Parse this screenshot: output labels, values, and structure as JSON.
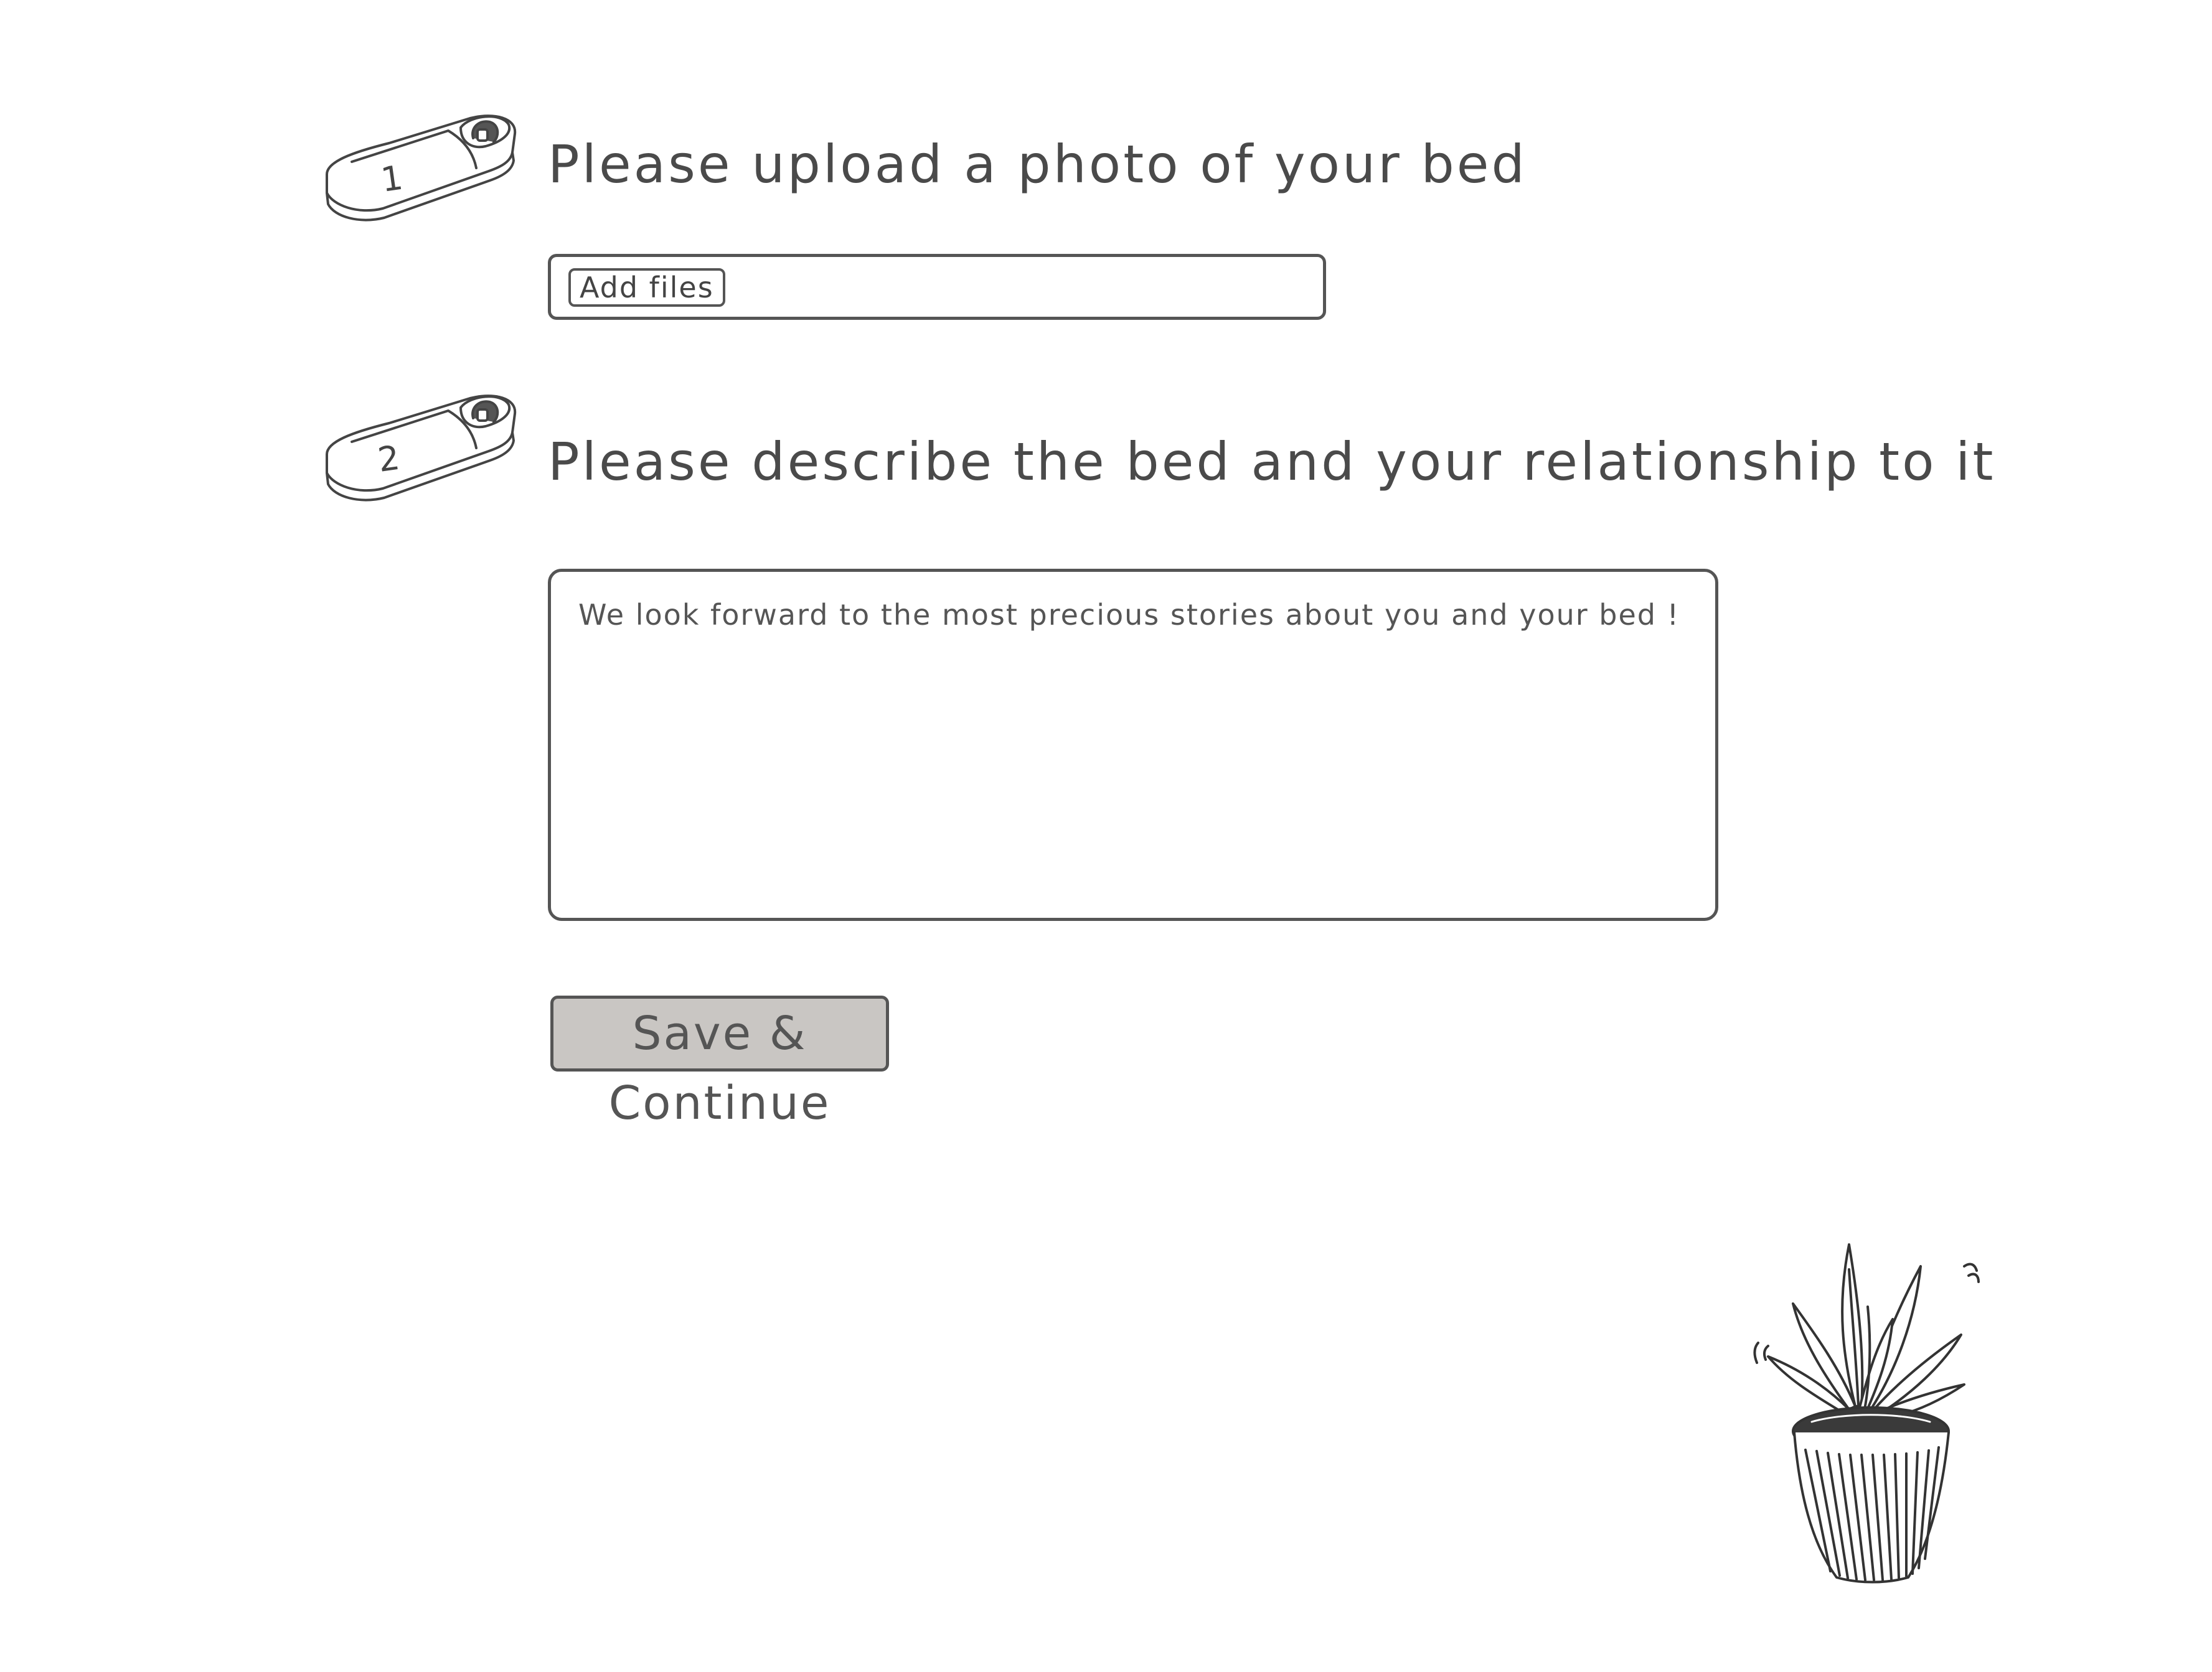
{
  "steps": [
    {
      "number": "1",
      "title": "Please upload a photo of your bed"
    },
    {
      "number": "2",
      "title": "Please describe the bed and your relationship to it"
    }
  ],
  "upload": {
    "button_label": "Add files"
  },
  "description": {
    "placeholder": "We look forward to the most precious stories about you and your bed !"
  },
  "actions": {
    "save_label": "Save & Continue"
  },
  "icons": {
    "step_icon": "bed-with-sleeper-icon",
    "decoration": "potted-plant-icon"
  },
  "colors": {
    "ink": "#4a4a4a",
    "button_fill": "#c9c6c3",
    "background": "#ffffff"
  }
}
